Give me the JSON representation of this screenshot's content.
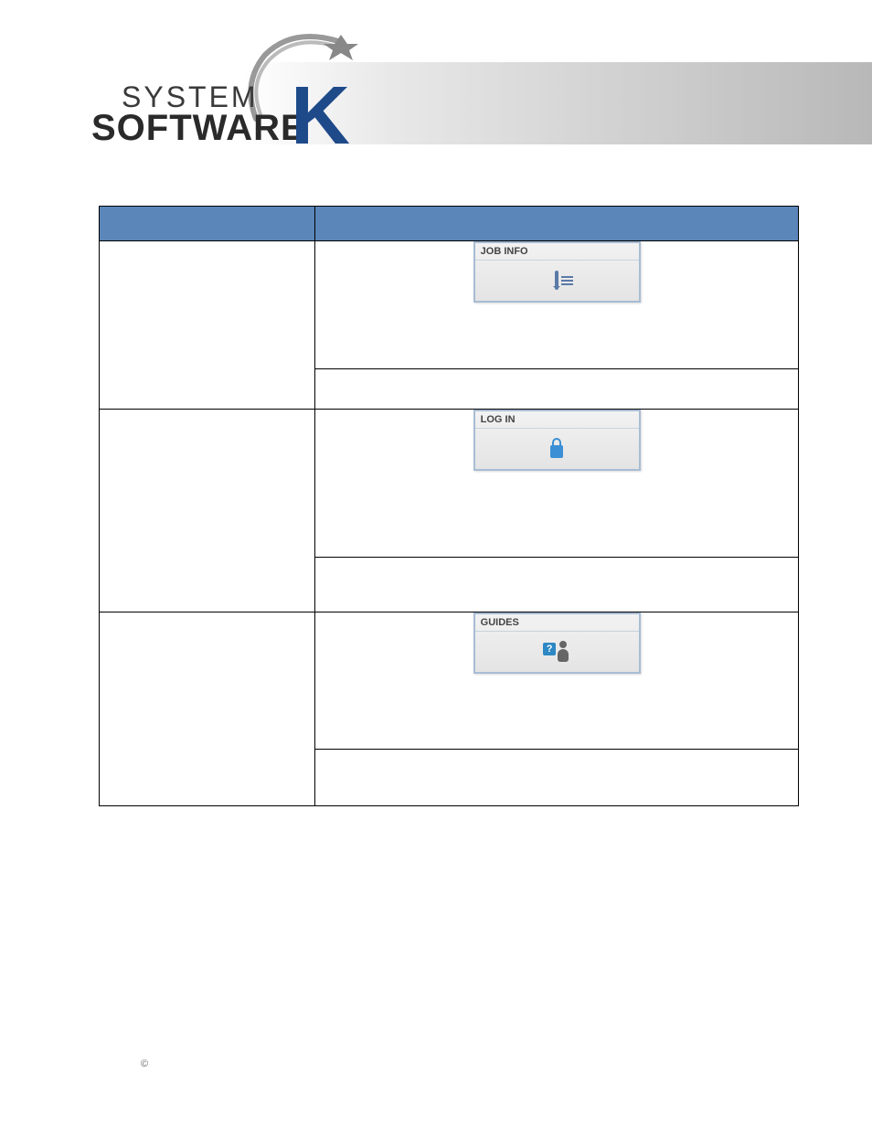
{
  "logo": {
    "line1": "SYSTEM",
    "line2": "SOFTWARE",
    "letter": "K"
  },
  "table": {
    "header_left": "",
    "header_right": "",
    "rows": [
      {
        "panel_title": "JOB INFO",
        "icon": "doc-icon"
      },
      {
        "panel_title": "LOG IN",
        "icon": "lock-icon"
      },
      {
        "panel_title": "GUIDES",
        "icon": "guides-icon"
      }
    ]
  },
  "footer": {
    "copyright": "©"
  }
}
